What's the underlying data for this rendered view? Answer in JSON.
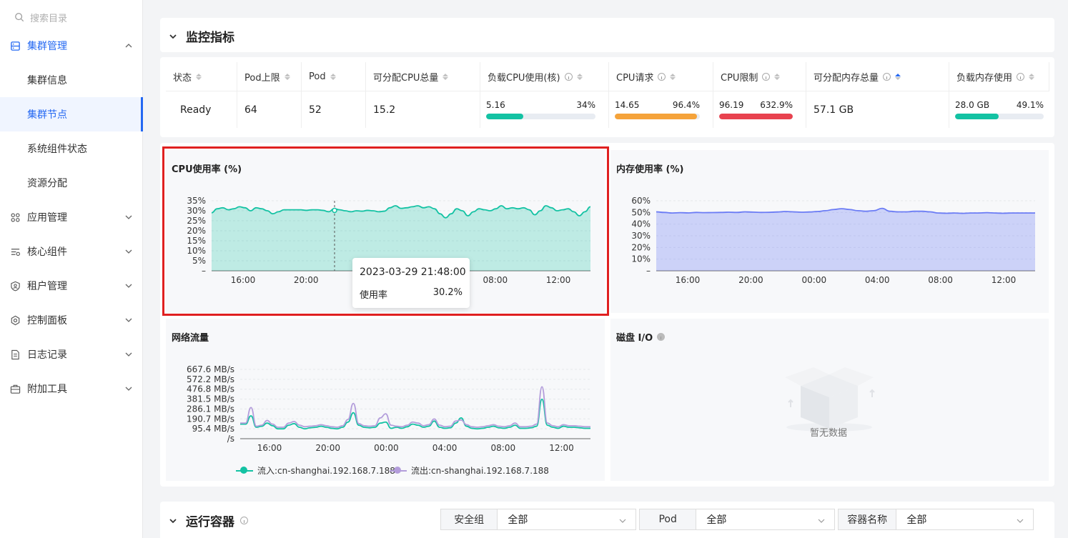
{
  "sidebar": {
    "search_placeholder": "搜索目录",
    "groups": [
      {
        "label": "集群管理",
        "icon": "cluster-icon"
      },
      {
        "label": "应用管理",
        "icon": "apps-icon"
      },
      {
        "label": "核心组件",
        "icon": "components-icon"
      },
      {
        "label": "租户管理",
        "icon": "tenant-icon"
      },
      {
        "label": "控制面板",
        "icon": "dashboard-icon"
      },
      {
        "label": "日志记录",
        "icon": "log-icon"
      },
      {
        "label": "附加工具",
        "icon": "toolbox-icon"
      }
    ],
    "sub_items": [
      {
        "label": "集群信息"
      },
      {
        "label": "集群节点"
      },
      {
        "label": "系统组件状态"
      },
      {
        "label": "资源分配"
      }
    ]
  },
  "monitor": {
    "title": "监控指标",
    "headers": [
      "状态",
      "Pod上限",
      "Pod",
      "可分配CPU总量",
      "负载CPU使用(核)",
      "CPU请求",
      "CPU限制",
      "可分配内存总量",
      "负载内存使用"
    ],
    "row": {
      "status": "Ready",
      "pod_limit": "64",
      "pod": "52",
      "cpu_alloc": "15.2",
      "cpu_load_value": "5.16",
      "cpu_load_pct": "34%",
      "cpu_load_fraction": 0.34,
      "cpu_req_value": "14.65",
      "cpu_req_pct": "96.4%",
      "cpu_req_fraction": 0.964,
      "cpu_lim_value": "96.19",
      "cpu_lim_pct": "632.9%",
      "cpu_lim_fraction": 1.0,
      "mem_alloc": "57.1 GB",
      "mem_load_value": "28.0 GB",
      "mem_load_pct": "49.1%",
      "mem_load_fraction": 0.491
    },
    "colors": {
      "teal": "#13c2a3",
      "orange": "#f5a33a",
      "red": "#e8424f"
    }
  },
  "charts": {
    "cpu": {
      "title": "CPU使用率 (%)"
    },
    "mem": {
      "title": "内存使用率 (%)"
    },
    "net": {
      "title": "网络流量"
    },
    "disk": {
      "title": "磁盘 I/O",
      "empty": "暂无数据"
    }
  },
  "tooltip": {
    "time": "2023-03-29 21:48:00",
    "label": "使用率",
    "value": "30.2%"
  },
  "chart_data": [
    {
      "type": "area",
      "title": "CPU使用率 (%)",
      "x_ticks": [
        "16:00",
        "20:00",
        "00:00",
        "04:00",
        "08:00",
        "12:00"
      ],
      "y_ticks": [
        "35%",
        "30%",
        "25%",
        "20%",
        "15%",
        "10%",
        "5%",
        "–"
      ],
      "ylim": [
        0,
        35
      ],
      "color": "#13c2a3",
      "values": [
        29,
        31,
        31.5,
        30.5,
        31,
        32,
        31.5,
        30,
        31.5,
        31,
        30,
        28.5,
        29.5,
        30.5,
        30.5,
        30.5,
        30.5,
        30.2,
        30.5,
        30.5,
        30.2,
        29.5,
        31,
        30.5,
        30,
        29.5,
        30,
        29.8,
        30.2,
        30,
        29.5,
        29.8,
        31.5,
        32.5,
        31.2,
        31.5,
        32,
        32.5,
        31.5,
        32,
        31,
        28.5,
        26.5,
        28.5,
        31,
        30,
        27.5,
        29.5,
        31,
        30.5,
        30,
        31,
        32.5,
        31,
        31.5,
        31,
        31.5,
        30.5,
        28,
        30,
        32.5,
        31.5,
        30,
        30.5,
        31,
        29.5,
        27.5,
        29.5,
        32
      ]
    },
    {
      "type": "area",
      "title": "内存使用率 (%)",
      "x_ticks": [
        "16:00",
        "20:00",
        "00:00",
        "04:00",
        "08:00",
        "12:00"
      ],
      "y_ticks": [
        "60%",
        "50%",
        "40%",
        "30%",
        "20%",
        "10%",
        "–"
      ],
      "ylim": [
        0,
        60
      ],
      "color": "#6b7cf5",
      "values": [
        50.5,
        50,
        49.5,
        49.8,
        49.6,
        50,
        49.8,
        49.9,
        50,
        50.2,
        50,
        50.5,
        50.3,
        50,
        50.1,
        50.4,
        50.8,
        50.5,
        50.2,
        50.4,
        50.8,
        51.5,
        52.5,
        53.2,
        52.5,
        51.5,
        51,
        51.5,
        53.5,
        51,
        50.5,
        50.5,
        51,
        51,
        50.5,
        49.5,
        49.3,
        49.5,
        49.2,
        49.5,
        49.5,
        49.8,
        49.5,
        49.3,
        49.5,
        49.5,
        49.5,
        49.5
      ]
    },
    {
      "type": "line",
      "title": "网络流量",
      "x_ticks": [
        "16:00",
        "20:00",
        "00:00",
        "04:00",
        "08:00",
        "12:00"
      ],
      "y_ticks": [
        "667.6 MB/s",
        "572.2 MB/s",
        "476.8 MB/s",
        "381.5 MB/s",
        "286.1 MB/s",
        "190.7 MB/s",
        "95.4 MB/s",
        "/s"
      ],
      "ylim": [
        0,
        667.6
      ],
      "series": [
        {
          "name": "流入:cn-shanghai.192.168.7.188",
          "color": "#13c2a3",
          "values": [
            140,
            140,
            220,
            110,
            120,
            150,
            125,
            95,
            95,
            130,
            145,
            110,
            95,
            105,
            110,
            120,
            110,
            100,
            95,
            110,
            160,
            250,
            130,
            110,
            105,
            110,
            150,
            160,
            100,
            110,
            100,
            115,
            140,
            130,
            110,
            120,
            170,
            110,
            100,
            105,
            150,
            200,
            120,
            100,
            95,
            100,
            110,
            120,
            105,
            100,
            110,
            130,
            100,
            100,
            105,
            120,
            380,
            130,
            110,
            100,
            120,
            110,
            110,
            105,
            100,
            100
          ]
        },
        {
          "name": "流出:cn-shanghai.192.168.7.188",
          "color": "#b39ddb",
          "values": [
            150,
            150,
            300,
            120,
            130,
            175,
            140,
            110,
            110,
            150,
            165,
            130,
            115,
            120,
            125,
            135,
            125,
            115,
            110,
            125,
            185,
            340,
            145,
            125,
            120,
            125,
            200,
            240,
            130,
            120,
            115,
            130,
            160,
            150,
            125,
            135,
            190,
            130,
            115,
            120,
            170,
            180,
            135,
            115,
            110,
            115,
            125,
            135,
            120,
            115,
            125,
            150,
            115,
            115,
            120,
            140,
            500,
            150,
            125,
            115,
            135,
            125,
            125,
            120,
            115,
            115
          ]
        }
      ]
    }
  ],
  "containers": {
    "title": "运行容器",
    "filters": [
      {
        "label": "安全组",
        "value": "全部"
      },
      {
        "label": "Pod",
        "value": "全部"
      },
      {
        "label": "容器名称",
        "value": "全部"
      }
    ]
  }
}
